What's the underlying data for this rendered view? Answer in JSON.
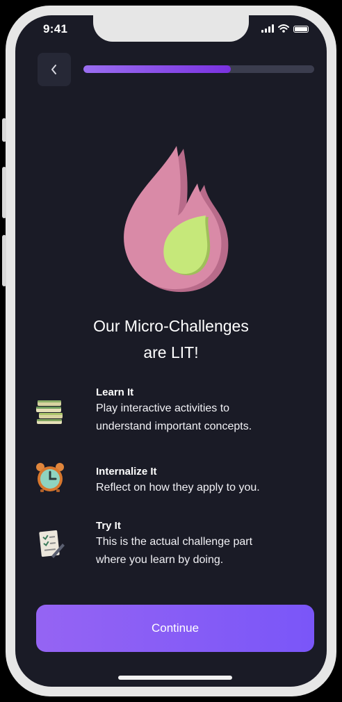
{
  "status_bar": {
    "time": "9:41"
  },
  "progress": {
    "value": 0.64
  },
  "heading": {
    "line1": "Our Micro-Challenges",
    "line2": "are LIT!"
  },
  "features": [
    {
      "icon": "books-icon",
      "title": "Learn It",
      "desc_line1": "Play interactive activities to",
      "desc_line2": "understand important concepts."
    },
    {
      "icon": "alarm-clock-icon",
      "title": "Internalize It",
      "desc_line1": "Reflect on how they apply to you.",
      "desc_line2": ""
    },
    {
      "icon": "checklist-icon",
      "title": "Try It",
      "desc_line1": "This is the actual challenge part",
      "desc_line2": "where you learn by doing."
    }
  ],
  "continue_label": "Continue",
  "colors": {
    "background": "#1a1b26",
    "accent": "#8a5cf5",
    "flame": "#d98aa7",
    "flame_core": "#c6e87a"
  }
}
